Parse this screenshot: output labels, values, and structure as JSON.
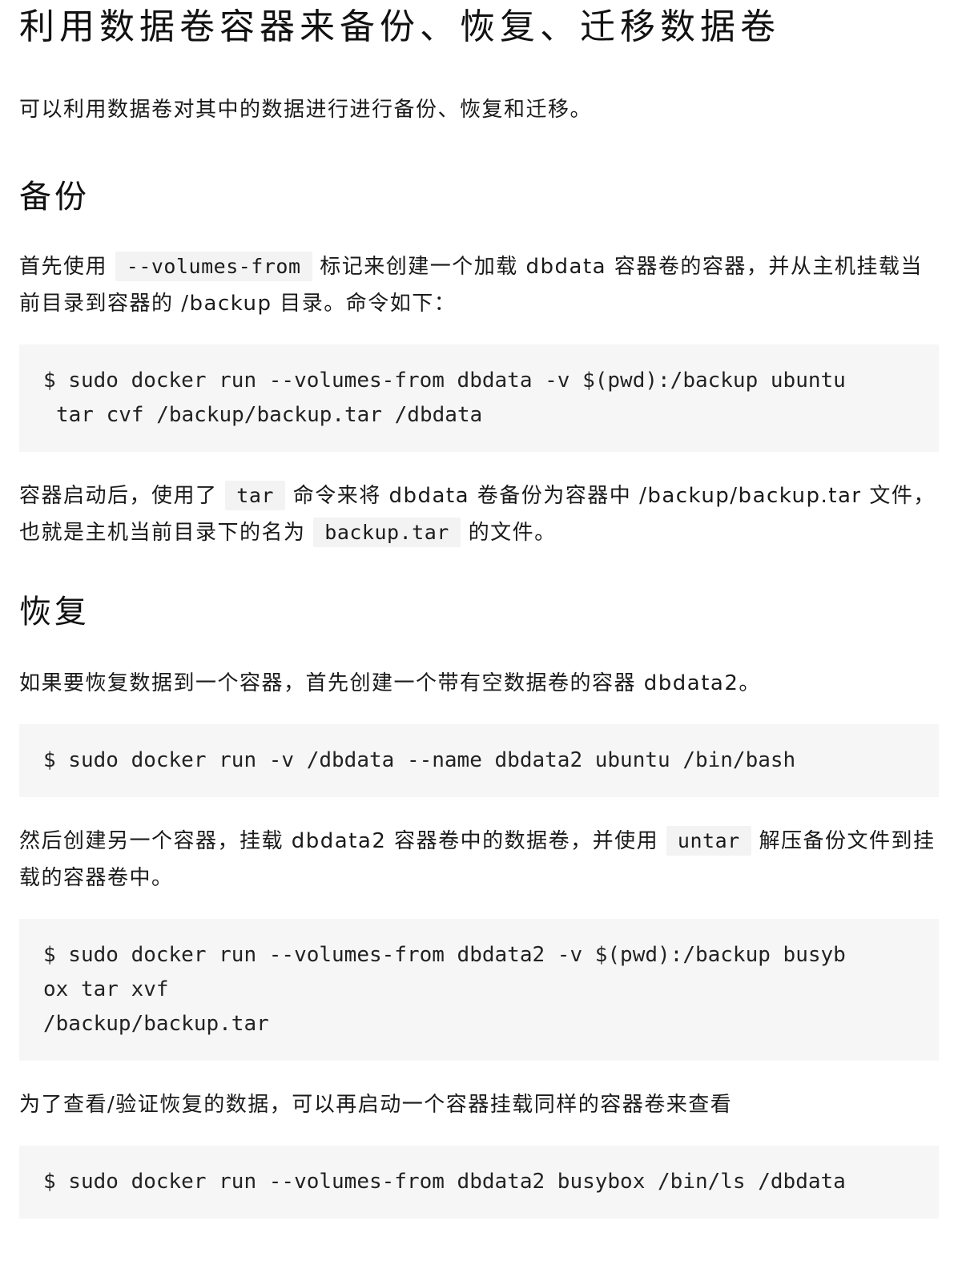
{
  "title": "利用数据卷容器来备份、恢复、迁移数据卷",
  "intro": "可以利用数据卷对其中的数据进行进行备份、恢复和迁移。",
  "backup": {
    "heading": "备份",
    "para1": {
      "before": "首先使用",
      "code": "--volumes-from",
      "after": "标记来创建一个加载 dbdata 容器卷的容器，并从主机挂载当前目录到容器的 /backup 目录。命令如下："
    },
    "code1": {
      "line1": "$ sudo docker run --volumes-from dbdata -v $(pwd):/backup ubuntu",
      "line2": "tar cvf /backup/backup.tar /dbdata"
    },
    "para2": {
      "before": "容器启动后，使用了",
      "code1": "tar",
      "middle": "命令来将 dbdata 卷备份为容器中 /backup/backup.tar 文件，也就是主机当前目录下的名为",
      "code2": "backup.tar",
      "after": "的文件。"
    }
  },
  "restore": {
    "heading": "恢复",
    "para1": "如果要恢复数据到一个容器，首先创建一个带有空数据卷的容器 dbdata2。",
    "code1": {
      "line1": "$ sudo docker run -v /dbdata --name dbdata2 ubuntu /bin/bash"
    },
    "para2": {
      "before": "然后创建另一个容器，挂载 dbdata2 容器卷中的数据卷，并使用",
      "code": "untar",
      "after": "解压备份文件到挂载的容器卷中。"
    },
    "code2": {
      "line1": "$ sudo docker run --volumes-from dbdata2 -v $(pwd):/backup busyb",
      "line2": "ox tar xvf",
      "line3": "/backup/backup.tar"
    },
    "para3": "为了查看/验证恢复的数据，可以再启动一个容器挂载同样的容器卷来查看",
    "code3": {
      "line1": "$ sudo docker run --volumes-from dbdata2 busybox /bin/ls /dbdata"
    }
  }
}
